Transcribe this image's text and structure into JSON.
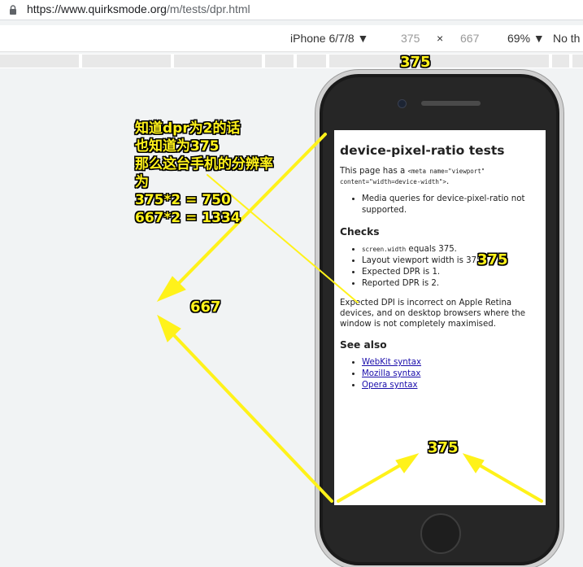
{
  "browser": {
    "url_host": "https://www.quirksmode.org",
    "url_path": "/m/tests/dpr.html"
  },
  "device_toolbar": {
    "device": "iPhone 6/7/8 ▼",
    "width": "375",
    "times": "×",
    "height": "667",
    "zoom": "69% ▼",
    "throttle": "No th"
  },
  "page": {
    "title": "device-pixel-ratio tests",
    "intro_prefix": "This page has a ",
    "intro_code": "<meta name=\"viewport\" content=\"width=device-width\">",
    "intro_suffix": ".",
    "bullets": [
      "Media queries for device-pixel-ratio not supported."
    ],
    "checks_heading": "Checks",
    "checks": {
      "screen_width_code": "screen.width",
      "screen_width_suffix": " equals 375.",
      "layout_viewport": "Layout viewport width is 375.",
      "expected_dpr": "Expected DPR is 1.",
      "reported_dpr": "Reported DPR is 2."
    },
    "note": "Expected DPI is incorrect on Apple Retina devices, and on desktop browsers where the window is not completely maximised.",
    "see_also_heading": "See also",
    "links": [
      "WebKit syntax",
      "Mozilla syntax",
      "Opera syntax"
    ]
  },
  "annotations": {
    "note_lines": [
      "知道dpr为2的话",
      "也知道为375",
      "那么这台手机的分辨率",
      "为",
      "375*2 = 750",
      "667*2 = 1334"
    ],
    "top_width": "375",
    "side_height": "667",
    "right_width": "375",
    "bottom_width": "375",
    "color": "#fff21a"
  }
}
